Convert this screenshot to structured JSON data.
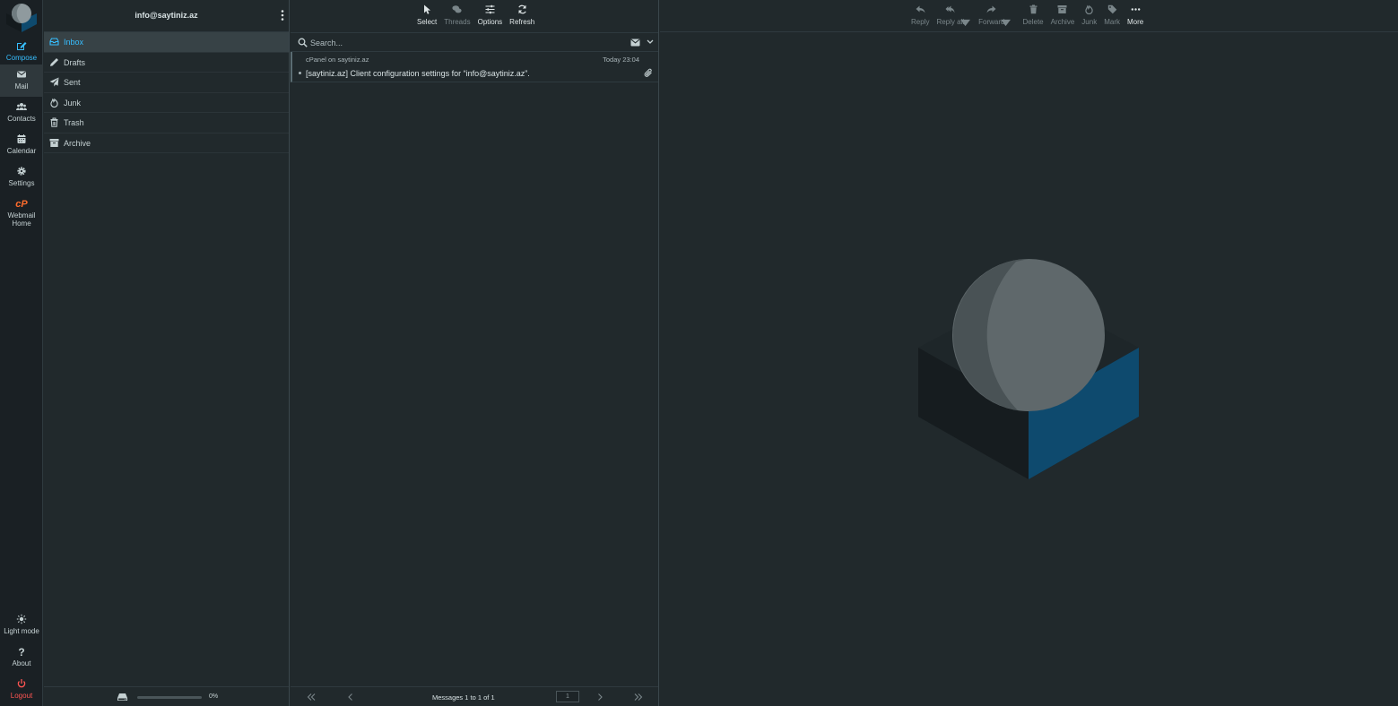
{
  "account": {
    "email": "info@saytiniz.az"
  },
  "nav": {
    "compose": "Compose",
    "mail": "Mail",
    "contacts": "Contacts",
    "calendar": "Calendar",
    "settings": "Settings",
    "webmail_home_1": "Webmail",
    "webmail_home_2": "Home",
    "light_mode": "Light mode",
    "about": "About",
    "logout": "Logout"
  },
  "folders": [
    {
      "name": "Inbox",
      "icon": "inbox-icon",
      "active": true
    },
    {
      "name": "Drafts",
      "icon": "pencil-icon"
    },
    {
      "name": "Sent",
      "icon": "paper-plane-icon"
    },
    {
      "name": "Junk",
      "icon": "fire-icon"
    },
    {
      "name": "Trash",
      "icon": "trash-icon"
    },
    {
      "name": "Archive",
      "icon": "archive-box-icon"
    }
  ],
  "quota": {
    "percent_text": "0%",
    "fraction": 0.0
  },
  "list_toolbar": {
    "select": "Select",
    "threads": "Threads",
    "options": "Options",
    "refresh": "Refresh"
  },
  "search": {
    "placeholder": "Search..."
  },
  "messages": [
    {
      "from": "cPanel on saytiniz.az",
      "date": "Today 23:04",
      "subject": "[saytiniz.az] Client configuration settings for “info@saytiniz.az”.",
      "has_attachment": true
    }
  ],
  "pagination": {
    "count_text": "Messages 1 to 1 of 1",
    "page": "1"
  },
  "message_toolbar": {
    "reply": "Reply",
    "reply_all": "Reply all",
    "forward": "Forward",
    "delete": "Delete",
    "archive": "Archive",
    "junk": "Junk",
    "mark": "Mark",
    "more": "More"
  },
  "colors": {
    "accent": "#37beff",
    "logout": "#ff5552",
    "background": "#21292c",
    "watermark_blue": "#0e4a6e"
  }
}
